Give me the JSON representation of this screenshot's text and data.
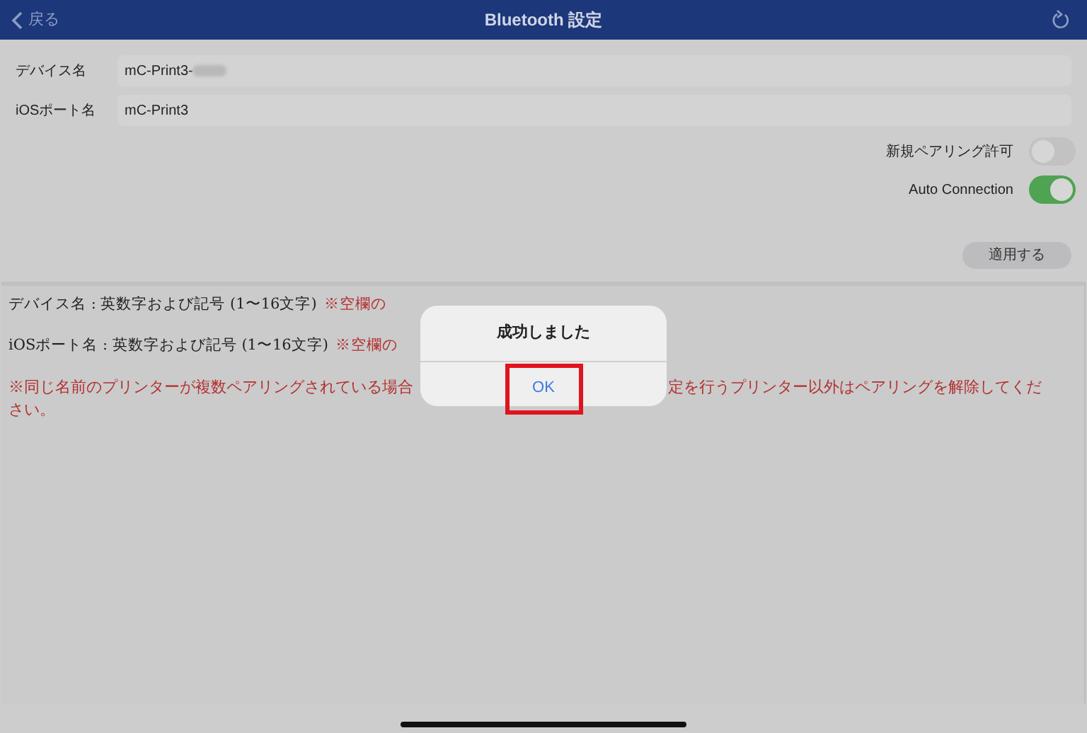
{
  "header": {
    "back": "戻る",
    "title": "Bluetooth 設定"
  },
  "fields": [
    {
      "label": "デバイス名",
      "value": "mC-Print3-",
      "blurred": true
    },
    {
      "label": "iOSポート名",
      "value": "mC-Print3",
      "blurred": false
    }
  ],
  "toggles": [
    {
      "label": "新規ペアリング許可",
      "on": false
    },
    {
      "label": "Auto Connection",
      "on": true
    }
  ],
  "apply_button": "適用する",
  "notes": [
    {
      "text": "デバイス名 : 英数字および記号 (1〜16文字)",
      "warning": "※空欄の"
    },
    {
      "text": "iOSポート名 : 英数字および記号 (1〜16文字)",
      "warning": "※空欄の"
    }
  ],
  "notice": {
    "left": "※同じ名前のプリンターが複数ペアリングされている場合",
    "right": "定を行うプリンター以外はペアリングを解除してくだ",
    "continuation": "さい。"
  },
  "dialog": {
    "title": "成功しました",
    "button": "OK",
    "highlighted": true
  }
}
